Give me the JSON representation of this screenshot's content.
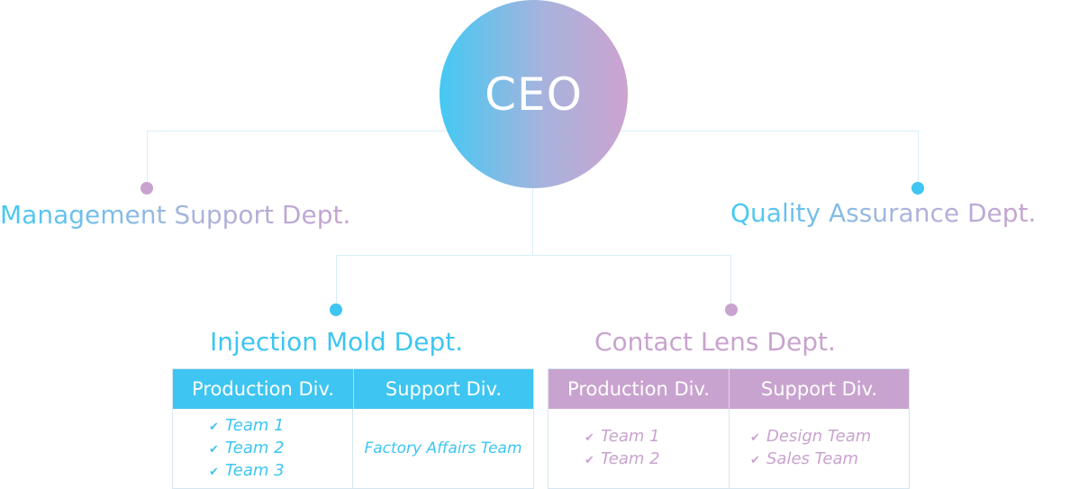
{
  "ceo": {
    "label": "CEO"
  },
  "top_departments": [
    {
      "name": "Management Support Dept."
    },
    {
      "name": "Quality Assurance Dept."
    }
  ],
  "departments": [
    {
      "name": "Injection Mold Dept.",
      "accent_color": "#3ec5f1",
      "divisions": [
        {
          "name": "Production Div.",
          "items": [
            "Team 1",
            "Team 2",
            "Team 3"
          ]
        },
        {
          "name": "Support Div.",
          "items": [
            "Factory Affairs Team"
          ]
        }
      ]
    },
    {
      "name": "Contact Lens Dept.",
      "accent_color": "#c9a3cf",
      "divisions": [
        {
          "name": "Production Div.",
          "items": [
            "Team 1",
            "Team 2"
          ]
        },
        {
          "name": "Support Div.",
          "items": [
            "Design Team",
            "Sales Team"
          ]
        }
      ]
    }
  ],
  "icons": {
    "check": "check-icon"
  },
  "colors": {
    "blue": "#3ec5f1",
    "pink": "#c9a3cf",
    "connector": "#d6eef8"
  }
}
